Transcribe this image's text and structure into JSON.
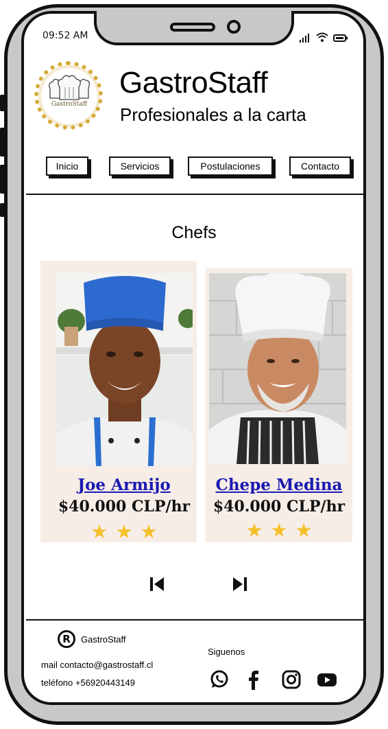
{
  "status_bar": {
    "time": "09:52 AM",
    "icons": [
      "signal-icon",
      "wifi-icon",
      "battery-icon"
    ]
  },
  "header": {
    "logo_text": "GastroStaff",
    "title": "GastroStaff",
    "subtitle": "Profesionales a la carta"
  },
  "nav": {
    "items": [
      {
        "label": "Inicio"
      },
      {
        "label": "Servicios"
      },
      {
        "label": "Postulaciones"
      },
      {
        "label": "Contacto"
      }
    ]
  },
  "main": {
    "section_title": "Chefs",
    "chefs": [
      {
        "name": "Joe Armijo",
        "price": "$40.000 CLP/hr",
        "rating": 3
      },
      {
        "name": "Chepe Medina",
        "price": "$40.000 CLP/hr",
        "rating": 3
      }
    ],
    "controls": [
      "skip-previous-icon",
      "skip-next-icon"
    ]
  },
  "footer": {
    "brand": "GastroStaff",
    "mail": "mail contacto@gastrostaff.cl",
    "phone": "teléfono +56920443149",
    "follow_label": "Siguenos",
    "social": [
      "whatsapp-icon",
      "facebook-icon",
      "instagram-icon",
      "youtube-icon"
    ]
  },
  "colors": {
    "card_background": "#f7ede7",
    "link_blue": "#1a1ab0",
    "star_yellow": "#f6c02b",
    "phone_frame": "#c8c8c8"
  }
}
